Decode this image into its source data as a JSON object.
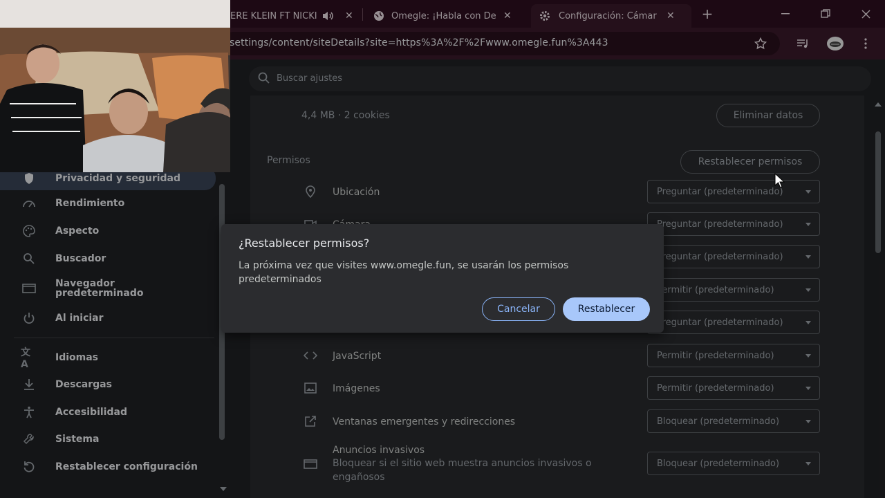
{
  "tabs": [
    {
      "title": "ERE KLEIN FT NICKI"
    },
    {
      "title": "Omegle: ¡Habla con De"
    },
    {
      "title": "Configuración: Cámar"
    }
  ],
  "omnibox": {
    "url": "settings/content/siteDetails?site=https%3A%2F%2Fwww.omegle.fun%3A443"
  },
  "search": {
    "placeholder": "Buscar ajustes"
  },
  "sidebar": {
    "items": [
      {
        "label": "Privacidad y seguridad",
        "icon": "shield-icon"
      },
      {
        "label": "Rendimiento",
        "icon": "speedometer-icon"
      },
      {
        "label": "Aspecto",
        "icon": "palette-icon"
      },
      {
        "label": "Buscador",
        "icon": "search-icon"
      },
      {
        "label": "Navegador predeterminado",
        "icon": "browser-window-icon"
      },
      {
        "label": "Al iniciar",
        "icon": "power-icon"
      },
      {
        "label": "Idiomas",
        "icon": "translate-icon"
      },
      {
        "label": "Descargas",
        "icon": "download-icon"
      },
      {
        "label": "Accesibilidad",
        "icon": "accessibility-icon"
      },
      {
        "label": "Sistema",
        "icon": "wrench-icon"
      },
      {
        "label": "Restablecer configuración",
        "icon": "reset-icon"
      }
    ]
  },
  "site": {
    "usage": "4,4 MB · 2 cookies",
    "clear_label": "Eliminar datos"
  },
  "permissions": {
    "heading": "Permisos",
    "reset_label": "Restablecer permisos",
    "rows": [
      {
        "label": "Ubicación",
        "value": "Preguntar (predeterminado)",
        "icon": "location-pin-icon"
      },
      {
        "label": "Cámara",
        "value": "Preguntar (predeterminado)",
        "icon": "camera-icon"
      },
      {
        "label": "",
        "value": "Preguntar (predeterminado)"
      },
      {
        "label": "",
        "value": "Permitir (predeterminado)"
      },
      {
        "label": "",
        "value": "Preguntar (predeterminado)"
      },
      {
        "label": "JavaScript",
        "value": "Permitir (predeterminado)",
        "icon": "code-icon"
      },
      {
        "label": "Imágenes",
        "value": "Permitir (predeterminado)",
        "icon": "image-icon"
      },
      {
        "label": "Ventanas emergentes y redirecciones",
        "value": "Bloquear (predeterminado)",
        "icon": "open-in-new-icon"
      },
      {
        "label": "Anuncios invasivos",
        "sub": "Bloquear si el sitio web muestra anuncios invasivos o engañosos",
        "value": "Bloquear (predeterminado)",
        "icon": "ad-window-icon"
      }
    ]
  },
  "dialog": {
    "title": "¿Restablecer permisos?",
    "body": "La próxima vez que visites www.omegle.fun, se usarán los permisos predeterminados",
    "cancel": "Cancelar",
    "confirm": "Restablecer"
  },
  "colors": {
    "tabstrip": "#2d0f1f",
    "toolbar": "#3a1a2a",
    "accent": "#a8c7fa",
    "accent_text": "#8ab4f8",
    "surface": "#292a2d"
  }
}
